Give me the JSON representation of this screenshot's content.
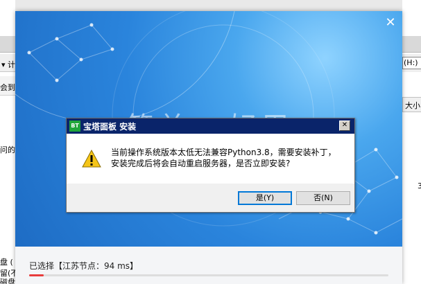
{
  "background": {
    "left_fragments": [
      "▾ 计",
      "会到(",
      "问的(",
      "盘 (",
      "留(不",
      "磁盘"
    ],
    "right_fragments": [
      "(H:)",
      "大小",
      "3"
    ]
  },
  "installer": {
    "close_glyph": "✕",
    "hero_title": "简单 · 好用",
    "node_status": "已选择【江苏节点：94 ms】",
    "progress_fraction": 0.04,
    "accent_color": "#e83c3c"
  },
  "dialog": {
    "logo_text": "BT",
    "title": "宝塔面板 安装",
    "close_label": "✕",
    "message_line1": "当前操作系统版本太低无法兼容Python3.8，需要安装补丁，",
    "message_line2": "安装完成后将会自动重启服务器，是否立即安装?",
    "yes_label": "是(Y)",
    "no_label": "否(N)",
    "icon": "warning-icon",
    "titlebar_color": "#0a246a"
  }
}
